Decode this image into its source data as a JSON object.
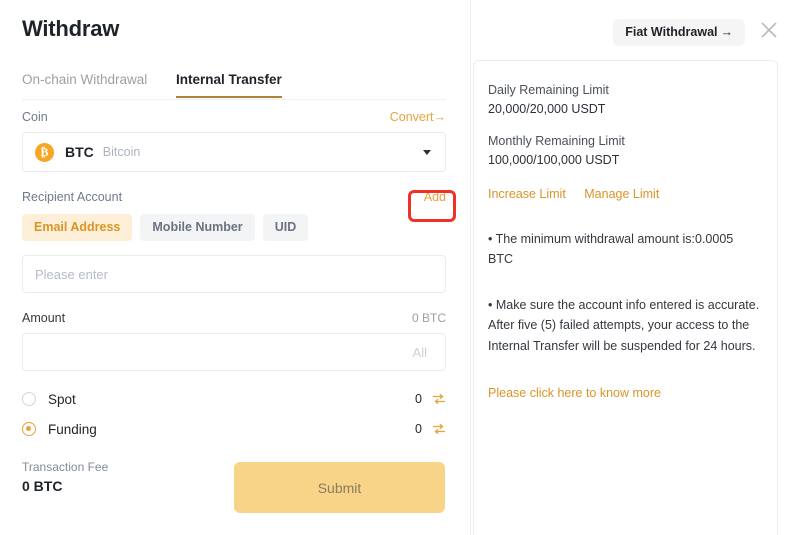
{
  "header": {
    "title": "Withdraw",
    "fiat_button": "Fiat Withdrawal",
    "fiat_button_arrow": "→",
    "close_icon": "close-icon"
  },
  "tabs": [
    {
      "label": "On-chain Withdrawal",
      "active": false
    },
    {
      "label": "Internal Transfer",
      "active": true
    }
  ],
  "form": {
    "coin": {
      "label": "Coin",
      "convert_link": "Convert",
      "convert_arrow": "→",
      "symbol": "BTC",
      "name": "Bitcoin",
      "icon_glyph": "₿"
    },
    "recipient": {
      "label": "Recipient Account",
      "add_link": "Add",
      "methods": [
        {
          "label": "Email Address",
          "active": true
        },
        {
          "label": "Mobile Number",
          "active": false
        },
        {
          "label": "UID",
          "active": false
        }
      ],
      "input_value": "",
      "input_placeholder": "Please enter"
    },
    "amount": {
      "label": "Amount",
      "available": "0 BTC",
      "input_value": "",
      "all_label": "All"
    },
    "accounts": [
      {
        "label": "Spot",
        "balance": "0",
        "selected": false
      },
      {
        "label": "Funding",
        "balance": "0",
        "selected": true
      }
    ],
    "fee": {
      "label": "Transaction Fee",
      "value": "0 BTC"
    },
    "submit_label": "Submit"
  },
  "side_panel": {
    "daily_limit_label": "Daily Remaining Limit",
    "daily_limit_value": "20,000/20,000 USDT",
    "monthly_limit_label": "Monthly Remaining Limit",
    "monthly_limit_value": "100,000/100,000 USDT",
    "increase_limit_link": "Increase Limit",
    "manage_limit_link": "Manage Limit",
    "note_1": "• The minimum withdrawal amount is:0.0005 BTC",
    "note_2": "• Make sure the account info entered is accurate. After five (5) failed attempts, your access to the Internal Transfer will be suspended for 24 hours.",
    "know_more_link": "Please click here to know more"
  },
  "colors": {
    "accent_orange": "#e8a33d",
    "link_orange": "#d99528",
    "submit_bg": "#f8d488",
    "annotation_red": "#f03226",
    "tab_underline": "#b0813b"
  }
}
